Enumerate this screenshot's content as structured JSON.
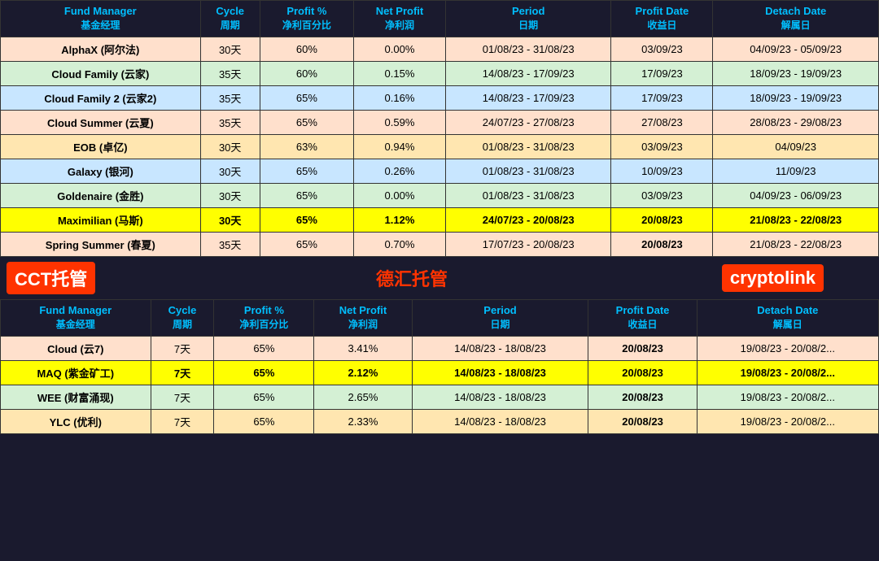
{
  "table1": {
    "headers": [
      {
        "label": "Fund Manager",
        "sub": "基金经理"
      },
      {
        "label": "Cycle",
        "sub": "周期"
      },
      {
        "label": "Profit %",
        "sub": "净利百分比"
      },
      {
        "label": "Net Profit",
        "sub": "净利润"
      },
      {
        "label": "Period",
        "sub": "日期"
      },
      {
        "label": "Profit Date",
        "sub": "收益日"
      },
      {
        "label": "Detach Date",
        "sub": "解属日"
      }
    ],
    "rows": [
      {
        "name": "AlphaX (阿尔法)",
        "cycle": "30天",
        "profit_pct": "60%",
        "net_profit": "0.00%",
        "period": "01/08/23 - 31/08/23",
        "profit_date": "03/09/23",
        "detach_date": "04/09/23 - 05/09/23",
        "row_class": "row-alphax",
        "profit_bold": false
      },
      {
        "name": "Cloud Family (云家)",
        "cycle": "35天",
        "profit_pct": "60%",
        "net_profit": "0.15%",
        "period": "14/08/23 - 17/09/23",
        "profit_date": "17/09/23",
        "detach_date": "18/09/23 - 19/09/23",
        "row_class": "row-cloudfamily",
        "profit_bold": false
      },
      {
        "name": "Cloud Family 2 (云家2)",
        "cycle": "35天",
        "profit_pct": "65%",
        "net_profit": "0.16%",
        "period": "14/08/23 - 17/09/23",
        "profit_date": "17/09/23",
        "detach_date": "18/09/23 - 19/09/23",
        "row_class": "row-cloudfamily2",
        "profit_bold": false
      },
      {
        "name": "Cloud Summer (云夏)",
        "cycle": "35天",
        "profit_pct": "65%",
        "net_profit": "0.59%",
        "period": "24/07/23 - 27/08/23",
        "profit_date": "27/08/23",
        "detach_date": "28/08/23 - 29/08/23",
        "row_class": "row-cloudsummer",
        "profit_bold": false
      },
      {
        "name": "EOB (卓亿)",
        "cycle": "30天",
        "profit_pct": "63%",
        "net_profit": "0.94%",
        "period": "01/08/23 - 31/08/23",
        "profit_date": "03/09/23",
        "detach_date": "04/09/23",
        "row_class": "row-eob",
        "profit_bold": false
      },
      {
        "name": "Galaxy (银河)",
        "cycle": "30天",
        "profit_pct": "65%",
        "net_profit": "0.26%",
        "period": "01/08/23 - 31/08/23",
        "profit_date": "10/09/23",
        "detach_date": "11/09/23",
        "row_class": "row-galaxy",
        "profit_bold": false
      },
      {
        "name": "Goldenaire (金胜)",
        "cycle": "30天",
        "profit_pct": "65%",
        "net_profit": "0.00%",
        "period": "01/08/23 - 31/08/23",
        "profit_date": "03/09/23",
        "detach_date": "04/09/23 - 06/09/23",
        "row_class": "row-goldenaire",
        "profit_bold": false
      },
      {
        "name": "Maximilian (马斯)",
        "cycle": "30天",
        "profit_pct": "65%",
        "net_profit": "1.12%",
        "period": "24/07/23 - 20/08/23",
        "profit_date": "20/08/23",
        "detach_date": "21/08/23 - 22/08/23",
        "row_class": "row-maximilian",
        "profit_bold": true
      },
      {
        "name": "Spring Summer (春夏)",
        "cycle": "35天",
        "profit_pct": "65%",
        "net_profit": "0.70%",
        "period": "17/07/23 - 20/08/23",
        "profit_date": "20/08/23",
        "detach_date": "21/08/23 - 22/08/23",
        "row_class": "row-springsummer",
        "profit_bold": true
      }
    ]
  },
  "labels": {
    "cct": "CCT托管",
    "dehui": "德汇托管",
    "cryptolink": "cryptolink"
  },
  "table2": {
    "headers": [
      {
        "label": "Fund Manager",
        "sub": "基金经理"
      },
      {
        "label": "Cycle",
        "sub": "周期"
      },
      {
        "label": "Profit %",
        "sub": "净利百分比"
      },
      {
        "label": "Net Profit",
        "sub": "净利润"
      },
      {
        "label": "Period",
        "sub": "日期"
      },
      {
        "label": "Profit Date",
        "sub": "收益日"
      },
      {
        "label": "Detach Date",
        "sub": "解属日"
      }
    ],
    "rows": [
      {
        "name": "Cloud (云7)",
        "cycle": "7天",
        "profit_pct": "65%",
        "net_profit": "3.41%",
        "period": "14/08/23 - 18/08/23",
        "profit_date": "20/08/23",
        "detach_date": "19/08/23 - 20/08/2...",
        "row_class": "row-cloud7",
        "profit_bold": true
      },
      {
        "name": "MAQ (紫金矿工)",
        "cycle": "7天",
        "profit_pct": "65%",
        "net_profit": "2.12%",
        "period": "14/08/23 - 18/08/23",
        "profit_date": "20/08/23",
        "detach_date": "19/08/23 - 20/08/2...",
        "row_class": "row-maq",
        "profit_bold": true
      },
      {
        "name": "WEE (财富涌现)",
        "cycle": "7天",
        "profit_pct": "65%",
        "net_profit": "2.65%",
        "period": "14/08/23 - 18/08/23",
        "profit_date": "20/08/23",
        "detach_date": "19/08/23 - 20/08/2...",
        "row_class": "row-wee",
        "profit_bold": true
      },
      {
        "name": "YLC (优利)",
        "cycle": "7天",
        "profit_pct": "65%",
        "net_profit": "2.33%",
        "period": "14/08/23 - 18/08/23",
        "profit_date": "20/08/23",
        "detach_date": "19/08/23 - 20/08/2...",
        "row_class": "row-ylc",
        "profit_bold": true
      }
    ]
  }
}
